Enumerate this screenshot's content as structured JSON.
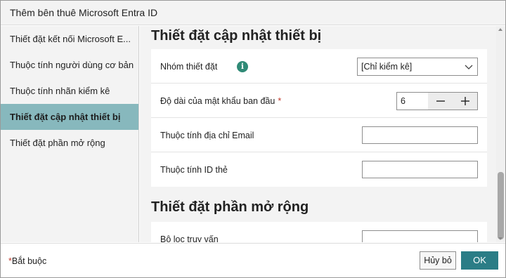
{
  "window": {
    "title": "Thêm bên thuê Microsoft Entra ID"
  },
  "sidebar": {
    "items": [
      {
        "label": "Thiết đặt kết nối Microsoft E..."
      },
      {
        "label": "Thuộc tính người dùng cơ bản"
      },
      {
        "label": "Thuộc tính nhãn kiểm kê"
      },
      {
        "label": "Thiết đặt cập nhật thiết bị",
        "active": true
      },
      {
        "label": "Thiết đặt phần mở rộng"
      }
    ]
  },
  "main": {
    "device_update": {
      "title": "Thiết đặt cập nhật thiết bị",
      "settings_group": {
        "label": "Nhóm thiết đặt",
        "value": "[Chỉ kiểm kê]"
      },
      "password_length": {
        "label": "Độ dài của mật khẩu ban đầu",
        "required_mark": "*",
        "value": "6"
      },
      "email_attribute": {
        "label": "Thuộc tính địa chỉ Email",
        "value": ""
      },
      "id_attribute": {
        "label": "Thuộc tính ID thẻ",
        "value": ""
      }
    },
    "extensions": {
      "title": "Thiết đặt phần mở rộng",
      "query_filter": {
        "label": "Bộ lọc truy vấn",
        "value": ""
      }
    }
  },
  "footer": {
    "required_star": "*",
    "required_label": "Bắt buộc",
    "cancel_label": "Hủy bỏ",
    "ok_label": "OK"
  },
  "icons": {
    "info": "info-icon",
    "chevron": "chevron-down-icon",
    "minus": "minus-icon",
    "plus": "plus-icon"
  },
  "colors": {
    "accent": "#2b7d86",
    "active_nav": "#87b8bd",
    "info_icon": "#2f8a76",
    "required": "#c0392b"
  }
}
